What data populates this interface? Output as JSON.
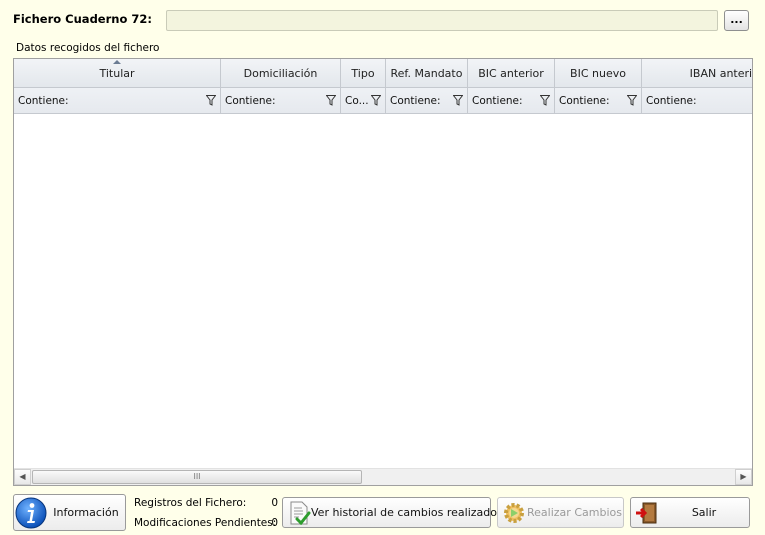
{
  "file": {
    "label": "Fichero Cuaderno 72:",
    "value": "",
    "browse_label": "..."
  },
  "grid": {
    "section_label": "Datos recogidos del fichero",
    "columns": [
      {
        "header": "Titular",
        "filter": "Contiene:",
        "sorted": "ascending"
      },
      {
        "header": "Domiciliación",
        "filter": "Contiene:"
      },
      {
        "header": "Tipo",
        "filter": "Co..."
      },
      {
        "header": "Ref. Mandato",
        "filter": "Contiene:"
      },
      {
        "header": "BIC anterior",
        "filter": "Contiene:"
      },
      {
        "header": "BIC nuevo",
        "filter": "Contiene:"
      },
      {
        "header": "IBAN anterior",
        "filter": "Contiene:"
      }
    ],
    "rows": [],
    "scroll_thumb_grip": "III"
  },
  "footer": {
    "info_button": "Información",
    "registros_label": "Registros del Fichero:",
    "registros_value": "0",
    "pendientes_label": "Modificaciones Pendientes:",
    "pendientes_value": "0",
    "history_button": "Ver historial de cambios realizados",
    "apply_button": "Realizar Cambios",
    "exit_button": "Salir"
  },
  "icons": {
    "info": "info-icon",
    "history": "document-check-icon",
    "apply": "gear-arrow-icon",
    "exit": "exit-door-icon",
    "filter": "filter-funnel-icon"
  }
}
